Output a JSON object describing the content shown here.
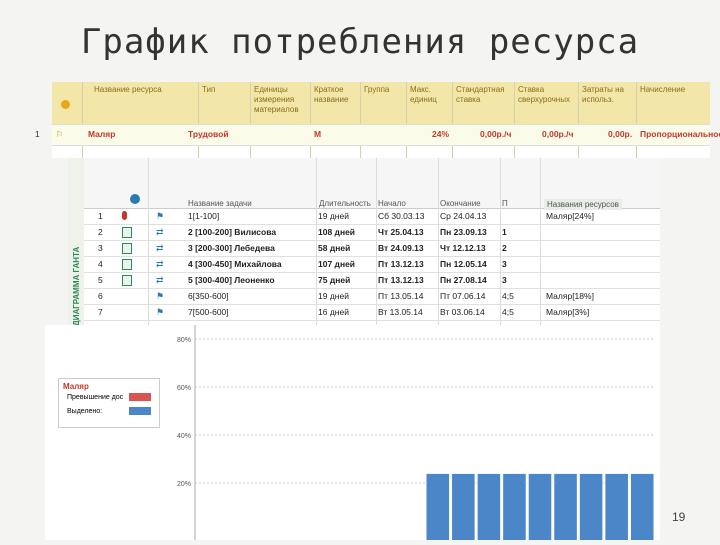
{
  "title": "График потребления ресурса",
  "resource_sheet": {
    "headers": [
      "Название ресурса",
      "Тип",
      "Единицы измерения материалов",
      "Краткое название",
      "Группа",
      "Макс. единиц",
      "Стандартная ставка",
      "Ставка сверхурочных",
      "Затраты на использ.",
      "Начисление"
    ],
    "row": {
      "num": "1",
      "name": "Маляр",
      "type": "Трудовой",
      "short": "М",
      "max_units": "24%",
      "std_rate": "0,00р./ч",
      "ovt_rate": "0,00р./ч",
      "cost_use": "0,00р.",
      "accrue": "Пропорциональное"
    }
  },
  "gantt": {
    "side_label": "ДИАГРАММА ГАНТА",
    "headers": [
      "Название задачи",
      "Длительность",
      "Начало",
      "Окончание",
      "П",
      "Названия ресурсов"
    ],
    "rows": [
      {
        "num": "1",
        "name": "1[1-100]",
        "dur": "19 дней",
        "start": "Сб 30.03.13",
        "end": "Ср 24.04.13",
        "pred": "",
        "res": "Маляр[24%]",
        "bold": false
      },
      {
        "num": "2",
        "name": "2 [100-200] Вилисова",
        "dur": "108 дней",
        "start": "Чт 25.04.13",
        "end": "Пн 23.09.13",
        "pred": "1",
        "res": "",
        "bold": true
      },
      {
        "num": "3",
        "name": "3 [200-300] Лебедева",
        "dur": "58 дней",
        "start": "Вт 24.09.13",
        "end": "Чт 12.12.13",
        "pred": "2",
        "res": "",
        "bold": true
      },
      {
        "num": "4",
        "name": "4 [300-450] Михайлова",
        "dur": "107 дней",
        "start": "Пт 13.12.13",
        "end": "Пн 12.05.14",
        "pred": "3",
        "res": "",
        "bold": true
      },
      {
        "num": "5",
        "name": "5 [300-400] Леоненко",
        "dur": "75 дней",
        "start": "Пт 13.12.13",
        "end": "Пн 27.08.14",
        "pred": "3",
        "res": "",
        "bold": true
      },
      {
        "num": "6",
        "name": "6[350-600]",
        "dur": "19 дней",
        "start": "Пт 13.05.14",
        "end": "Пт 07.06.14",
        "pred": "4;5",
        "res": "Маляр[18%]",
        "bold": false
      },
      {
        "num": "7",
        "name": "7[500-600]",
        "dur": "16 дней",
        "start": "Вт 13.05.14",
        "end": "Вт 03.06.14",
        "pred": "4;5",
        "res": "Маляр[3%]",
        "bold": false
      }
    ]
  },
  "legend": {
    "title": "Маляр",
    "over": "Превышение доступности:",
    "alloc": "Выделено:",
    "over_color": "#d9534f",
    "alloc_color": "#4a86c8"
  },
  "chart_data": {
    "type": "bar",
    "ytick_labels": [
      "80%",
      "60%",
      "40%",
      "20%"
    ],
    "ylim": [
      0,
      80
    ],
    "values": [
      0,
      0,
      0,
      0,
      0,
      0,
      0,
      0,
      0,
      24,
      24,
      24,
      24,
      24,
      24,
      24,
      24,
      24
    ],
    "bar_color": "#4a86c8",
    "grid": true
  },
  "page_number": "19"
}
